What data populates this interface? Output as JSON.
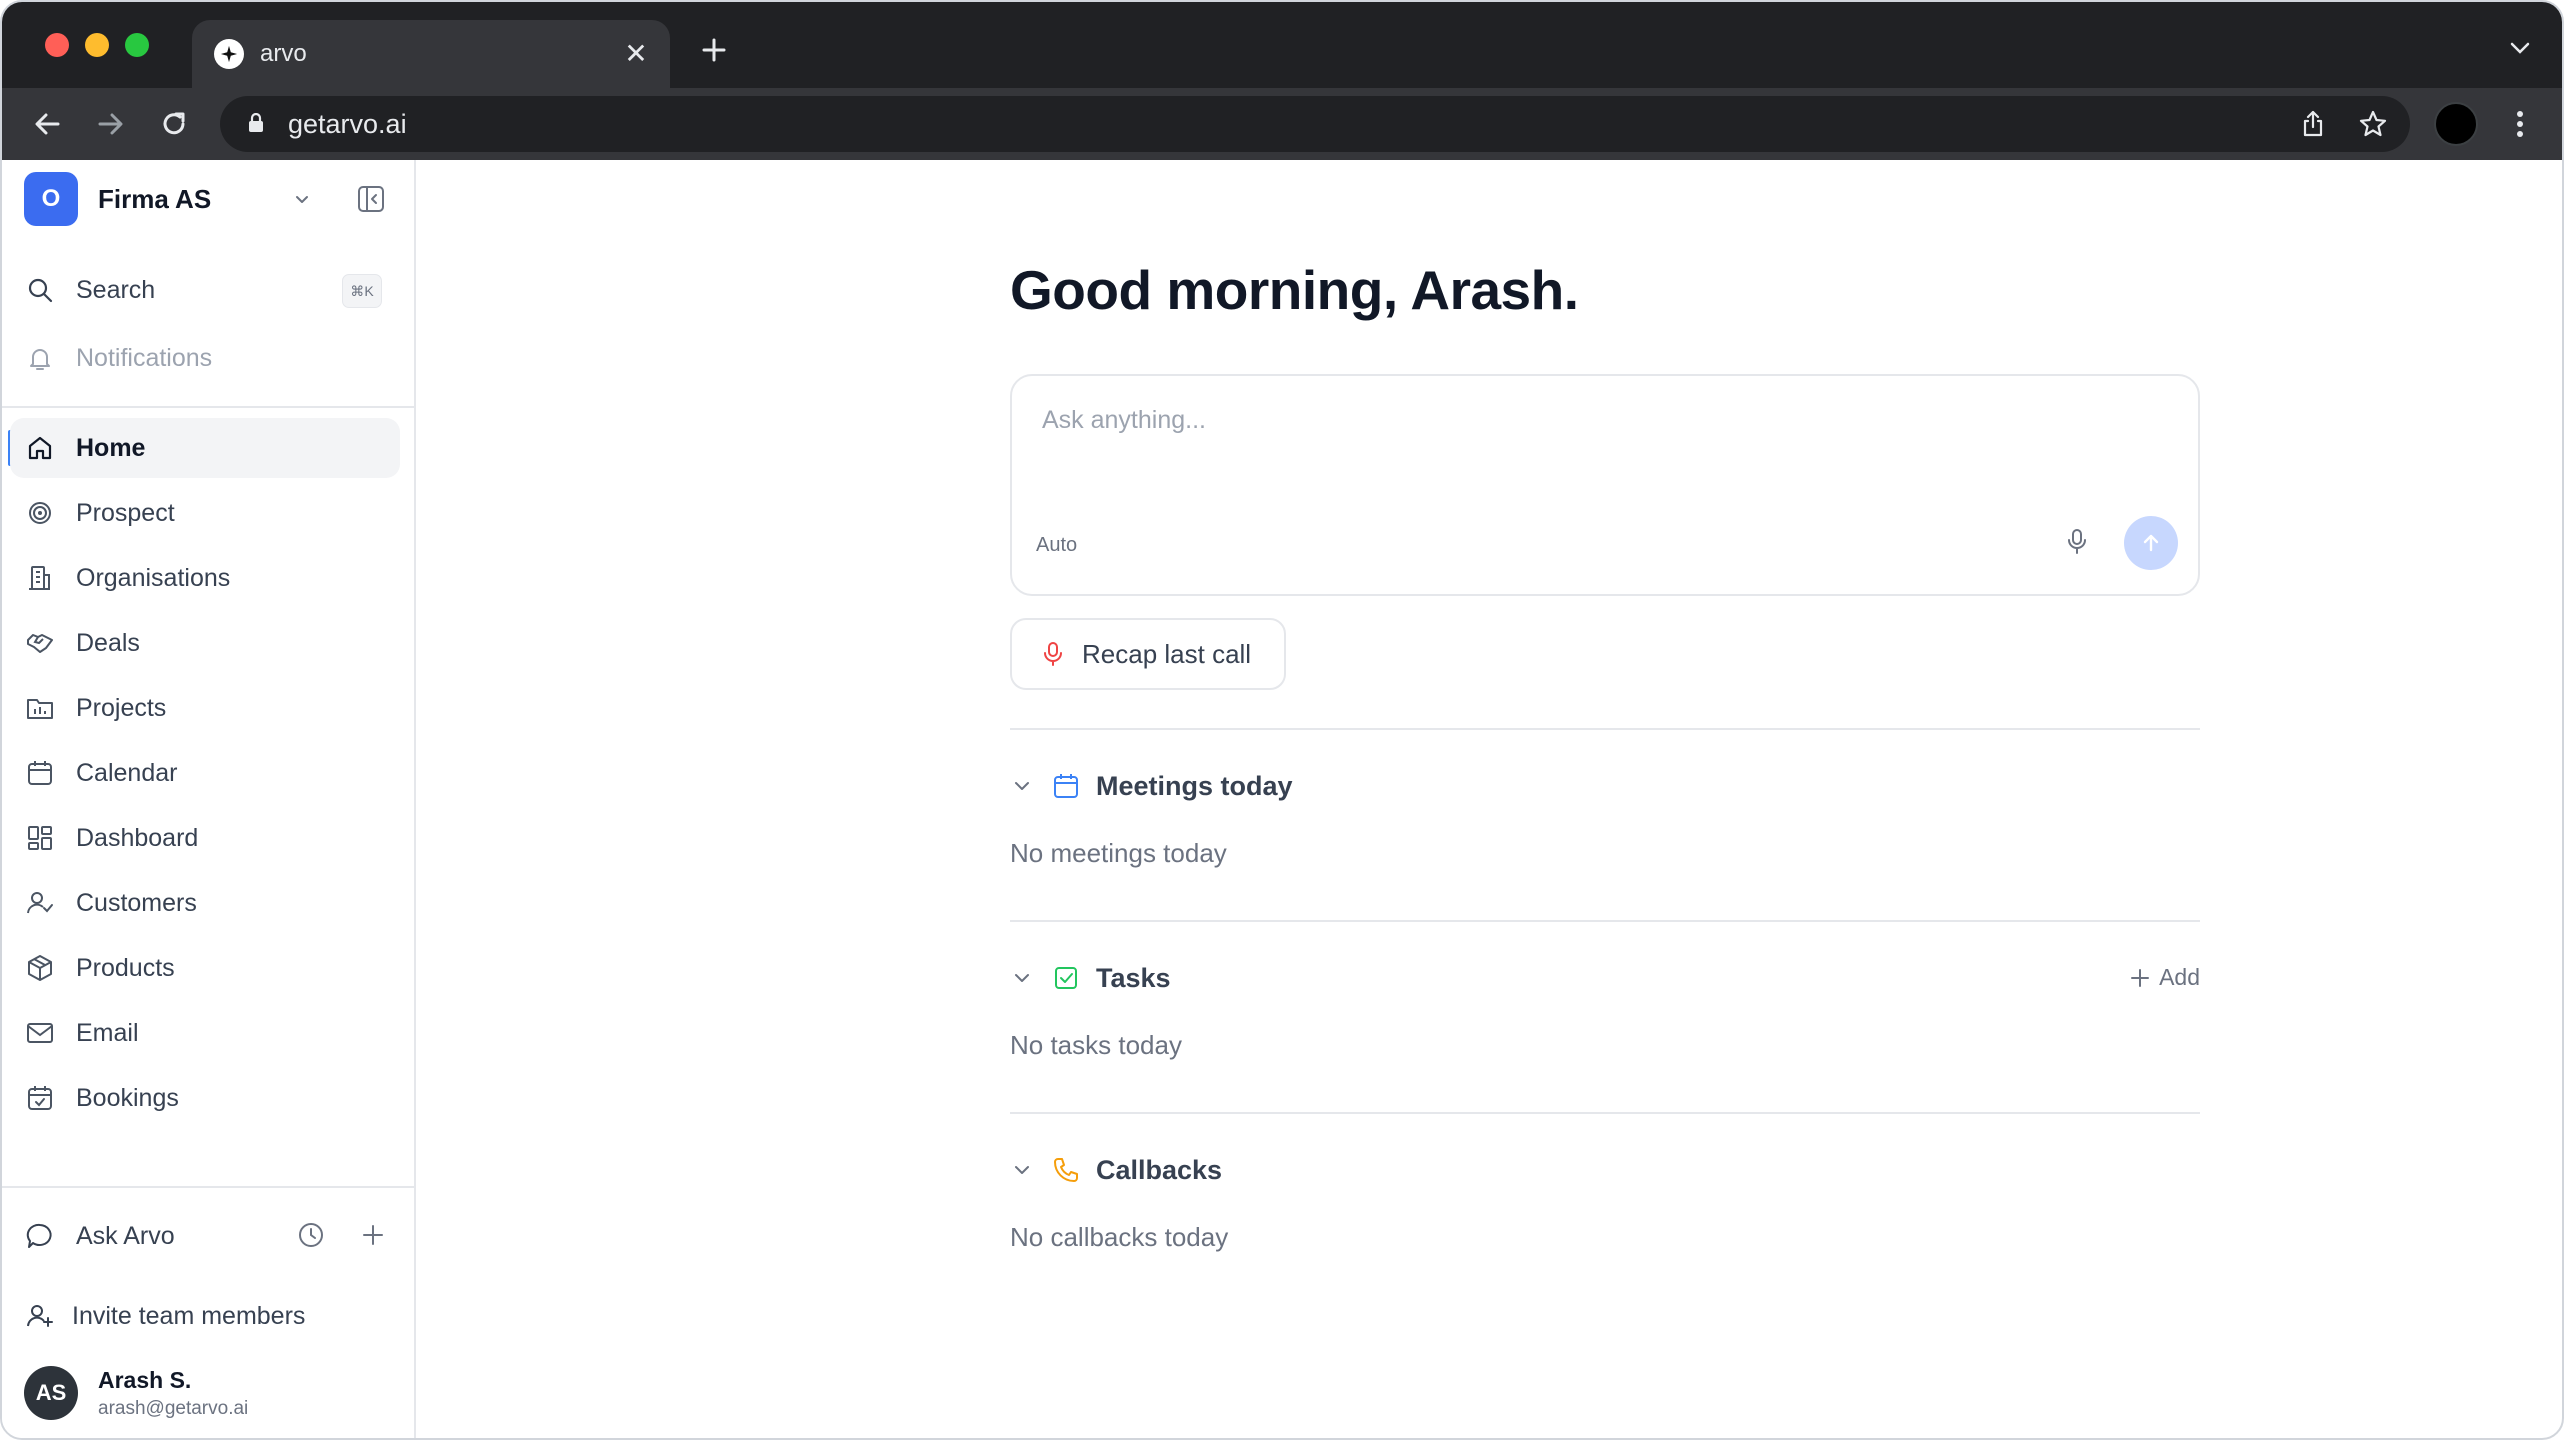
{
  "browser": {
    "tab_title": "arvo",
    "url": "getarvo.ai"
  },
  "workspace": {
    "badge": "O",
    "name": "Firma AS"
  },
  "sidebar": {
    "search_label": "Search",
    "search_shortcut": "⌘K",
    "notifications_label": "Notifications",
    "nav": [
      {
        "label": "Home",
        "icon": "home-icon",
        "active": true
      },
      {
        "label": "Prospect",
        "icon": "target-icon"
      },
      {
        "label": "Organisations",
        "icon": "building-icon"
      },
      {
        "label": "Deals",
        "icon": "handshake-icon"
      },
      {
        "label": "Projects",
        "icon": "folder-chart-icon"
      },
      {
        "label": "Calendar",
        "icon": "calendar-icon"
      },
      {
        "label": "Dashboard",
        "icon": "dashboard-grid-icon"
      },
      {
        "label": "Customers",
        "icon": "user-check-icon"
      },
      {
        "label": "Products",
        "icon": "package-icon"
      },
      {
        "label": "Email",
        "icon": "mail-icon"
      },
      {
        "label": "Bookings",
        "icon": "calendar-check-icon"
      }
    ],
    "ask_arvo_label": "Ask Arvo",
    "invite_label": "Invite team members",
    "user": {
      "initials": "AS",
      "name": "Arash S.",
      "email": "arash@getarvo.ai"
    }
  },
  "main": {
    "greeting": "Good morning, Arash.",
    "ask_placeholder": "Ask anything...",
    "mode_label": "Auto",
    "recap_label": "Recap last call",
    "sections": {
      "meetings": {
        "title": "Meetings today",
        "empty": "No meetings today"
      },
      "tasks": {
        "title": "Tasks",
        "empty": "No tasks today",
        "add_label": "Add"
      },
      "callbacks": {
        "title": "Callbacks",
        "empty": "No callbacks today"
      }
    }
  },
  "colors": {
    "accent": "#3b6cf0",
    "send_button": "#c7d7fe",
    "mic_red": "#ef4444",
    "tasks_green": "#22c55e",
    "callbacks_amber": "#f59e0b",
    "meetings_blue": "#3b82f6"
  }
}
